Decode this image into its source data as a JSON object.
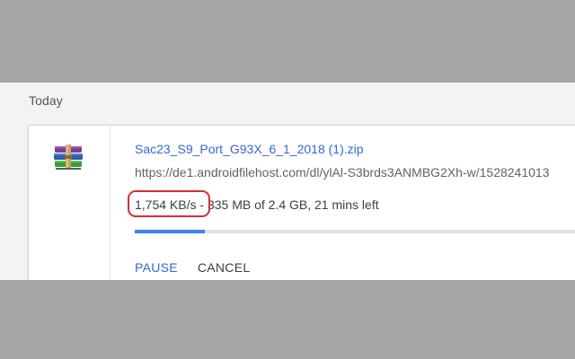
{
  "section": {
    "heading": "Today"
  },
  "download": {
    "icon": "winrar-archive-icon",
    "file_name": "Sac23_S9_Port_G93X_6_1_2018 (1).zip",
    "url": "https://de1.androidfilehost.com/dl/ylAl-S3brds3ANMBG2Xh-w/1528241013",
    "speed": "1,754 KB/s",
    "separator": " - ",
    "progress_text": "335 MB of 2.4 GB, 21 mins left",
    "progress_fraction": 0.155,
    "pause_label": "PAUSE",
    "cancel_label": "CANCEL"
  },
  "colors": {
    "link": "#3367d6",
    "progress": "#3f83f7",
    "highlight": "#d92b3a"
  }
}
